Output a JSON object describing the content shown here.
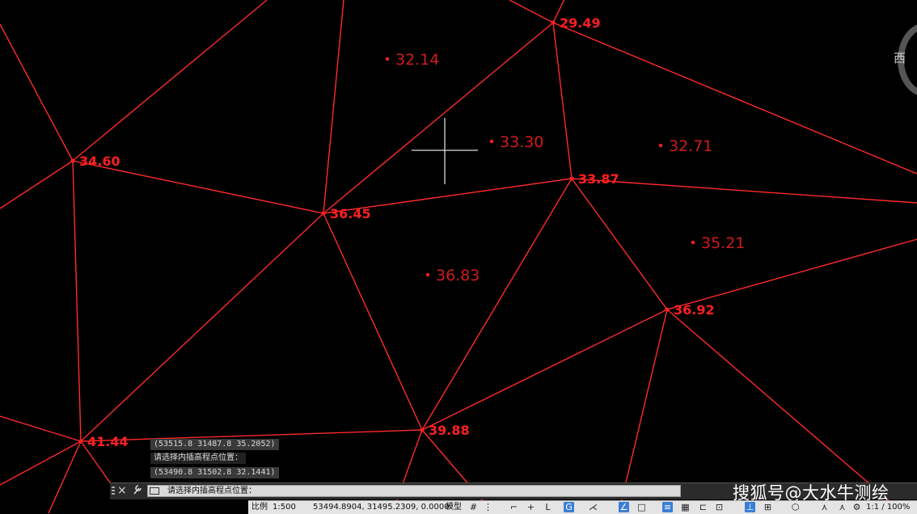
{
  "drawing": {
    "elevation_points": [
      {
        "label": "29.49",
        "style": "bold"
      },
      {
        "label": "34.60",
        "style": "bold"
      },
      {
        "label": "36.45",
        "style": "bold"
      },
      {
        "label": "33.87",
        "style": "bold"
      },
      {
        "label": "36.92",
        "style": "bold"
      },
      {
        "label": "39.88",
        "style": "bold"
      },
      {
        "label": "41.44",
        "style": "bold"
      },
      {
        "label": "32.14",
        "style": "interpolated"
      },
      {
        "label": "33.30",
        "style": "interpolated"
      },
      {
        "label": "32.71",
        "style": "interpolated"
      },
      {
        "label": "35.21",
        "style": "interpolated"
      },
      {
        "label": "36.83",
        "style": "interpolated"
      }
    ],
    "line_color": "#ff2a2a",
    "label_color": "#ff2020",
    "background": "#000000"
  },
  "viewcube": {
    "label": "西"
  },
  "command_history": [
    "(53515.8 31487.8 35.2052)",
    "请选择内插高程点位置：",
    "(53490.8 31502.8 32.1441)"
  ],
  "command_line": {
    "prompt": "请选择内插高程点位置：",
    "close_icon": "×",
    "wrench_icon": "🔧"
  },
  "watermark": "搜狐号@大水牛测绘",
  "status_bar": {
    "scale_label": "比例",
    "scale_value": "1:500",
    "coordinates": "53494.8904, 31495.2309, 0.0000",
    "model_label": "模型",
    "zoom": "1:1 / 100%",
    "icons": [
      "grid-icon",
      "snap-icon",
      "ortho-icon",
      "polar-icon",
      "osnap-icon",
      "otrack-icon",
      "lineweight-icon",
      "transparency-icon",
      "selection-icon",
      "annotation-icon",
      "workspace-icon",
      "isolate-icon",
      "settings-icon"
    ]
  }
}
